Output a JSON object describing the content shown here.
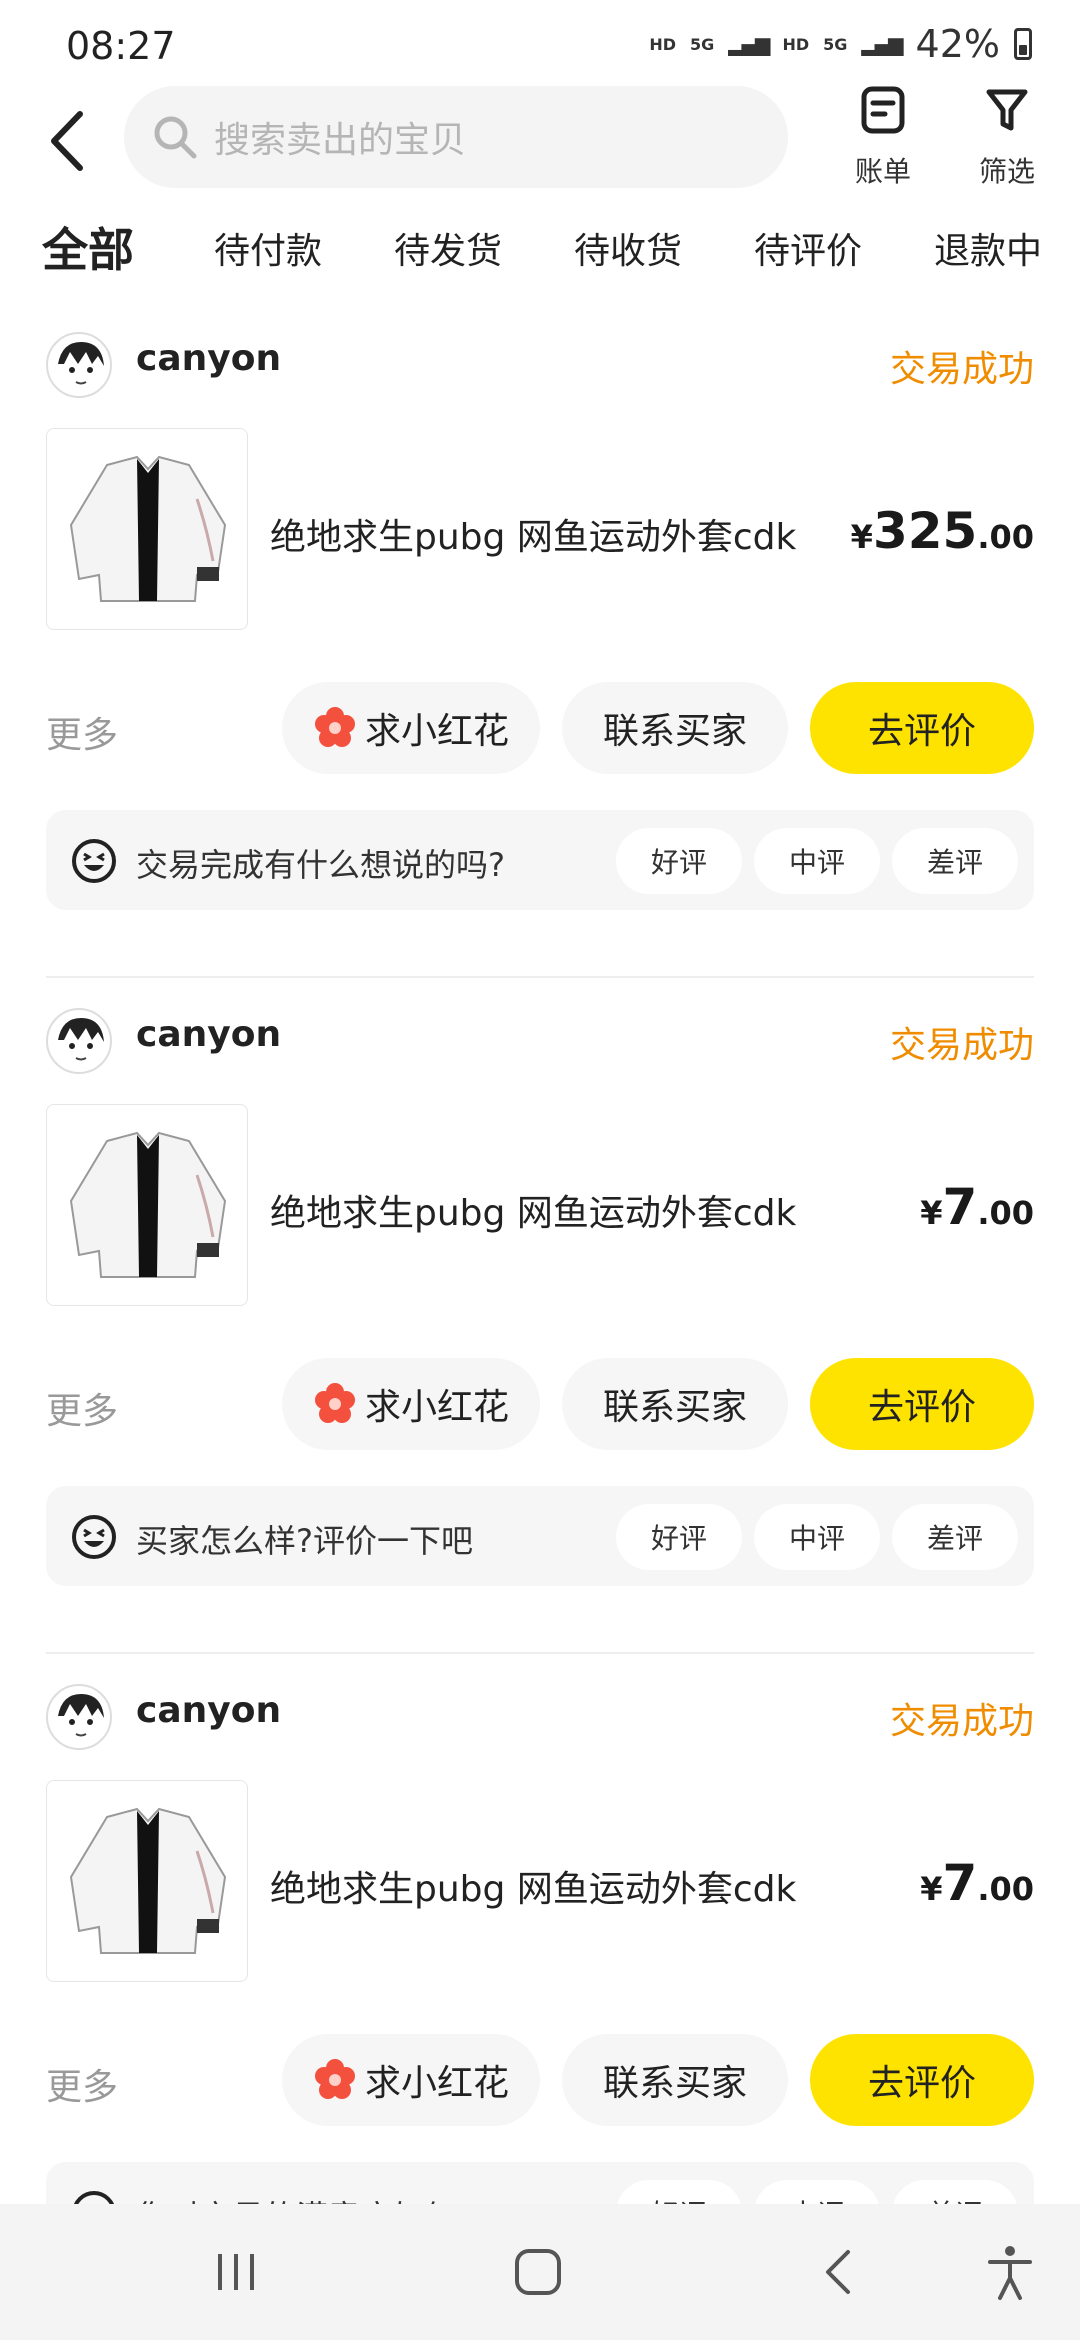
{
  "status_bar": {
    "time": "08:27",
    "network1": "HD",
    "network2": "5G",
    "network3": "HD",
    "network4": "5G",
    "battery": "42%"
  },
  "header": {
    "search_placeholder": "搜索卖出的宝贝",
    "bill_label": "账单",
    "filter_label": "筛选"
  },
  "tabs": [
    {
      "label": "全部",
      "active": true
    },
    {
      "label": "待付款"
    },
    {
      "label": "待发货"
    },
    {
      "label": "待收货"
    },
    {
      "label": "待评价"
    },
    {
      "label": "退款中"
    }
  ],
  "orders": [
    {
      "buyer": "canyon",
      "status": "交易成功",
      "title": "绝地求生pubg 网鱼运动外套cdk",
      "price_currency": "¥",
      "price_int": "325",
      "price_dec": ".00",
      "more": "更多",
      "flower_btn": "求小红花",
      "contact_btn": "联系买家",
      "review_btn": "去评价",
      "prompt": "交易完成有什么想说的吗?",
      "good": "好评",
      "mid": "中评",
      "bad": "差评"
    },
    {
      "buyer": "canyon",
      "status": "交易成功",
      "title": "绝地求生pubg 网鱼运动外套cdk",
      "price_currency": "¥",
      "price_int": "7",
      "price_dec": ".00",
      "more": "更多",
      "flower_btn": "求小红花",
      "contact_btn": "联系买家",
      "review_btn": "去评价",
      "prompt": "买家怎么样?评价一下吧",
      "good": "好评",
      "mid": "中评",
      "bad": "差评"
    },
    {
      "buyer": "canyon",
      "status": "交易成功",
      "title": "绝地求生pubg 网鱼运动外套cdk",
      "price_currency": "¥",
      "price_int": "7",
      "price_dec": ".00",
      "more": "更多",
      "flower_btn": "求小红花",
      "contact_btn": "联系买家",
      "review_btn": "去评价",
      "prompt": "您对交易的满意度如何?",
      "good": "好评",
      "mid": "中评",
      "bad": "差评"
    }
  ],
  "colors": {
    "accent_yellow": "#ffe300",
    "status_orange": "#f08c00"
  }
}
